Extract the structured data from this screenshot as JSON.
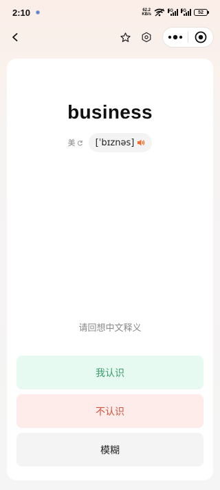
{
  "status_bar": {
    "time": "2:10",
    "net_speed_value": "62.2",
    "net_speed_unit": "KB/s",
    "sim1_label": "5G",
    "sim2_label": "5G",
    "battery": "52"
  },
  "nav": {
    "back_icon": "chevron-left-icon",
    "star_icon": "star-outline-icon",
    "settings_icon": "hexagon-settings-icon",
    "more_icon": "more-dots-icon",
    "close_icon": "target-close-icon"
  },
  "card": {
    "word": "business",
    "accent_label": "美",
    "phonetic": "[ˈbɪznəs]",
    "hint": "请回想中文释义",
    "buttons": {
      "know": "我认识",
      "unknown": "不认识",
      "vague": "模糊"
    }
  },
  "colors": {
    "speaker": "#f26b2c",
    "know_text": "#3b9b6a",
    "know_bg": "#e6faf1",
    "unknown_text": "#d5533f",
    "unknown_bg": "#fdece9"
  }
}
